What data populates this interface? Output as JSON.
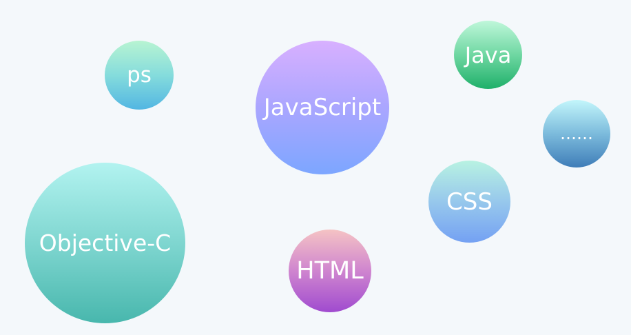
{
  "bubbles": {
    "javascript": {
      "label": "JavaScript"
    },
    "objective_c": {
      "label": "Objective-C"
    },
    "ps": {
      "label": "ps"
    },
    "java": {
      "label": "Java"
    },
    "more": {
      "label": "……"
    },
    "css": {
      "label": "CSS"
    },
    "html": {
      "label": "HTML"
    }
  },
  "colors": {
    "background": "#f4f8fb",
    "text": "#ffffff"
  }
}
